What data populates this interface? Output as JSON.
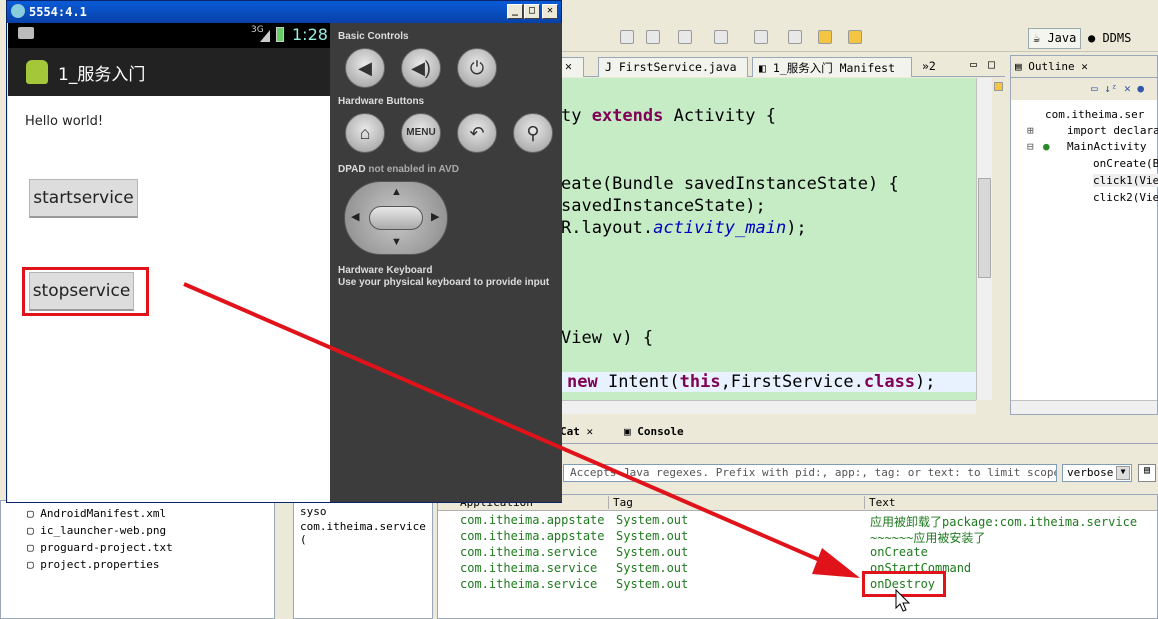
{
  "emulator": {
    "title": "5554:4.1",
    "status": {
      "signal": "3G",
      "time": "1:28"
    },
    "app_title": "1_服务入门",
    "hello": "Hello world!",
    "start_button": "startservice",
    "stop_button": "stopservice",
    "controls": {
      "basic_label": "Basic Controls",
      "hardware_label": "Hardware Buttons",
      "menu_label": "MENU",
      "dpad_label": "DPAD",
      "dpad_note": "not enabled in AVD",
      "keyboard_label": "Hardware Keyboard",
      "keyboard_note": "Use your physical keyboard to provide input"
    }
  },
  "eclipse": {
    "perspectives": [
      "Java",
      "DDMS"
    ],
    "editor_tabs": [
      "FirstService.java",
      "1_服务入门 Manifest",
      "»2"
    ],
    "code_lines": [
      {
        "parts": [
          [
            "ty ",
            ""
          ],
          [
            "extends",
            "kw"
          ],
          [
            " Activity {",
            ""
          ]
        ]
      },
      {
        "parts": [
          [
            "eate(Bundle savedInstanceState) {",
            ""
          ]
        ]
      },
      {
        "parts": [
          [
            "savedInstanceState);",
            ""
          ]
        ]
      },
      {
        "parts": [
          [
            "R.layout.",
            ""
          ],
          [
            "activity_main",
            "fld"
          ],
          [
            ");",
            ""
          ]
        ]
      },
      {
        "parts": [
          [
            "View v) {",
            ""
          ]
        ]
      },
      {
        "parts": [
          [
            "new",
            "kw"
          ],
          [
            " Intent(",
            ""
          ],
          [
            "this",
            "kw"
          ],
          [
            ",FirstService.",
            ""
          ],
          [
            "class",
            "kw"
          ],
          [
            ");",
            ""
          ]
        ]
      }
    ],
    "outline": {
      "title": "Outline",
      "items": [
        "com.itheima.ser",
        "import declarat",
        "MainActivity",
        "onCreate(Bu",
        "click1(View",
        "click2(View"
      ]
    },
    "bottom_tabs": [
      "Cat",
      "Console"
    ],
    "filter_placeholder": "Accepts Java regexes. Prefix with pid:, app:, tag: or text: to limit scope.",
    "log_level": "verbose",
    "log_columns": [
      "Application",
      "Tag",
      "Text"
    ],
    "log_rows": [
      [
        "com.itheima.appstate",
        "System.out",
        "应用被卸载了package:com.itheima.service"
      ],
      [
        "com.itheima.appstate",
        "System.out",
        "~~~~~~应用被安装了"
      ],
      [
        "com.itheima.service",
        "System.out",
        "onCreate"
      ],
      [
        "com.itheima.service",
        "System.out",
        "onStartCommand"
      ],
      [
        "com.itheima.service",
        "System.out",
        "onDestroy"
      ]
    ],
    "explorer_files": [
      "AndroidManifest.xml",
      "ic_launcher-web.png",
      "proguard-project.txt",
      "project.properties"
    ],
    "filter_list": [
      "syso",
      "com.itheima.service ("
    ]
  },
  "annotation_color": "#e1131a"
}
